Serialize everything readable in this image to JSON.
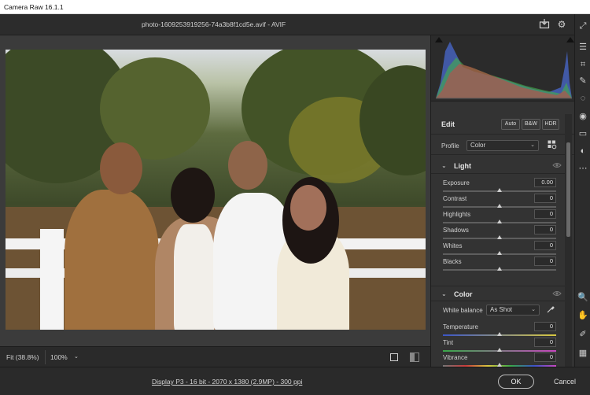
{
  "window": {
    "title": "Camera Raw 16.1.1"
  },
  "file": {
    "name": "photo-1609253919256-74a3b8f1cd5e.avif  -  AVIF"
  },
  "top_icons": [
    "save-download-icon",
    "gear-icon",
    "fullscreen-toggle-icon"
  ],
  "zoom": {
    "fit_label": "Fit (38.8%)",
    "percent_label": "100%"
  },
  "edit": {
    "title": "Edit",
    "buttons": {
      "auto": "Auto",
      "bw": "B&W",
      "hdr": "HDR"
    },
    "profile_label": "Profile",
    "profile_value": "Color"
  },
  "light": {
    "title": "Light",
    "sliders": [
      {
        "label": "Exposure",
        "value": "0.00"
      },
      {
        "label": "Contrast",
        "value": "0"
      },
      {
        "label": "Highlights",
        "value": "0"
      },
      {
        "label": "Shadows",
        "value": "0"
      },
      {
        "label": "Whites",
        "value": "0"
      },
      {
        "label": "Blacks",
        "value": "0"
      }
    ]
  },
  "color": {
    "title": "Color",
    "wb_label": "White balance",
    "wb_value": "As Shot",
    "sliders": [
      {
        "label": "Temperature",
        "value": "0"
      },
      {
        "label": "Tint",
        "value": "0"
      },
      {
        "label": "Vibrance",
        "value": "0"
      }
    ]
  },
  "footer": {
    "meta": "Display P3 - 16 bit - 2070 x 1380 (2.9MP) - 300 ppi",
    "ok": "OK",
    "cancel": "Cancel"
  },
  "colors": {
    "panel_bg": "#333333",
    "accent": "#cfcfcf",
    "photo_sky": "#d8dce0"
  }
}
